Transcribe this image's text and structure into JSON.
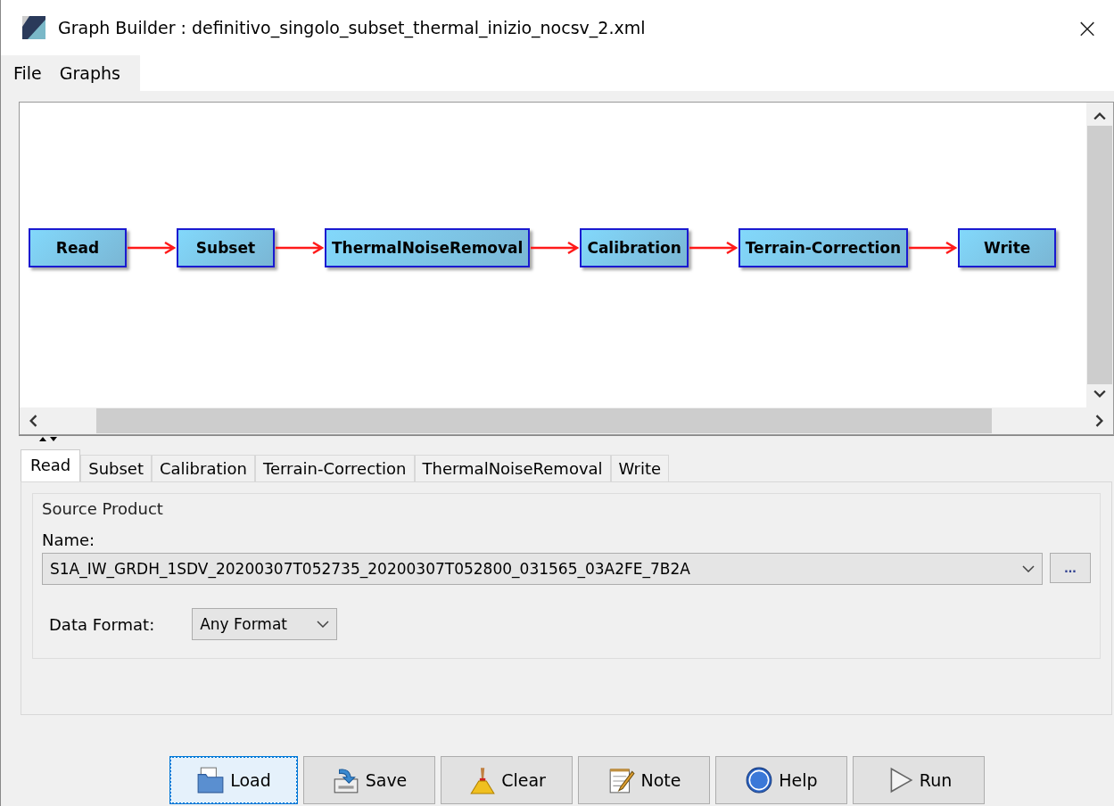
{
  "window": {
    "title": "Graph Builder : definitivo_singolo_subset_thermal_inizio_nocsv_2.xml",
    "close": "×"
  },
  "menu": [
    "File",
    "Graphs"
  ],
  "graph": {
    "nodes": [
      {
        "label": "Read"
      },
      {
        "label": "Subset"
      },
      {
        "label": "ThermalNoiseRemoval"
      },
      {
        "label": "Calibration"
      },
      {
        "label": "Terrain-Correction"
      },
      {
        "label": "Write"
      }
    ]
  },
  "tabs": [
    {
      "label": "Read",
      "selected": true
    },
    {
      "label": "Subset",
      "selected": false
    },
    {
      "label": "Calibration",
      "selected": false
    },
    {
      "label": "Terrain-Correction",
      "selected": false
    },
    {
      "label": "ThermalNoiseRemoval",
      "selected": false
    },
    {
      "label": "Write",
      "selected": false
    }
  ],
  "source_product": {
    "title": "Source Product",
    "name_label": "Name:",
    "name_value": "S1A_IW_GRDH_1SDV_20200307T052735_20200307T052800_031565_03A2FE_7B2A",
    "browse": "...",
    "format_label": "Data Format:",
    "format_value": "Any Format"
  },
  "buttons": [
    {
      "label": "Load",
      "kind": "load",
      "focused": true
    },
    {
      "label": "Save",
      "kind": "save",
      "focused": false
    },
    {
      "label": "Clear",
      "kind": "clear",
      "focused": false
    },
    {
      "label": "Note",
      "kind": "note",
      "focused": false
    },
    {
      "label": "Help",
      "kind": "help",
      "focused": false
    },
    {
      "label": "Run",
      "kind": "run",
      "focused": false
    }
  ]
}
